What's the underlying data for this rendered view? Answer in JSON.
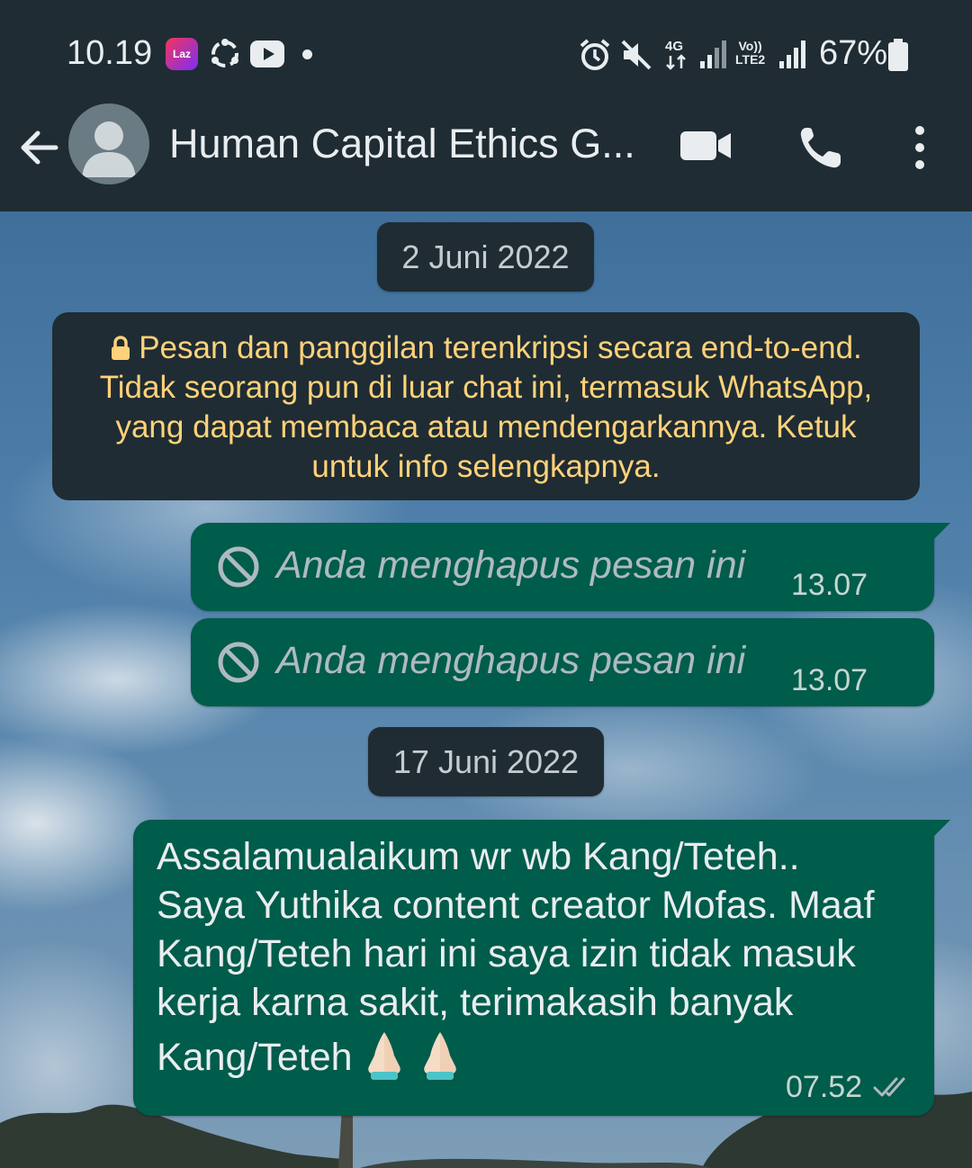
{
  "status_bar": {
    "time": "10.19",
    "laz_label": "Laz",
    "network_4g": "4G",
    "network_lte": "Vo))\nLTE2",
    "battery_percent": "67%"
  },
  "app_bar": {
    "chat_title": "Human Capital Ethics G..."
  },
  "chat": {
    "date_1": "2 Juni 2022",
    "encryption_notice": "Pesan dan panggilan terenkripsi secara end-to-end. Tidak seorang pun di luar chat ini, termasuk WhatsApp, yang dapat membaca atau mendengarkannya. Ketuk untuk info selengkapnya.",
    "deleted_messages": [
      {
        "text": "Anda menghapus pesan ini",
        "time": "13.07"
      },
      {
        "text": "Anda menghapus pesan ini",
        "time": "13.07"
      }
    ],
    "date_2": "17 Juni 2022",
    "message": {
      "text": "Assalamualaikum wr wb Kang/Teteh.. Saya Yuthika content creator Mofas. Maaf Kang/Teteh hari ini saya izin tidak masuk kerja karna sakit, terimakasih banyak Kang/Teteh",
      "time": "07.52"
    }
  },
  "colors": {
    "header_bg": "#1f2c34",
    "outgoing_bubble": "#005c4b",
    "notice_text": "#ffd279"
  }
}
